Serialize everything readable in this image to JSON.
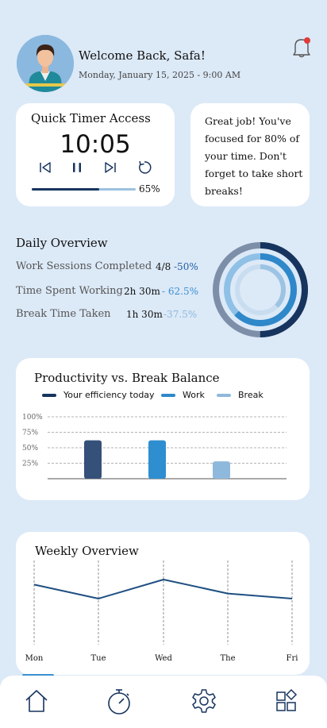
{
  "header": {
    "welcome": "Welcome Back, Safa!",
    "date": "Monday, January 15, 2025 - 9:00 AM",
    "notification_icon": "bell-icon",
    "has_notification": true
  },
  "timer": {
    "title": "Quick Timer Access",
    "time": "10:05",
    "progress": 0.65,
    "progress_label": "65%",
    "controls": [
      "skip-back-icon",
      "pause-icon",
      "skip-forward-icon",
      "restart-icon"
    ]
  },
  "tip": {
    "text": "Great job! You've focused for 80% of your time. Don't forget to take short breaks!"
  },
  "daily": {
    "title": "Daily Overview",
    "stats": [
      {
        "label": "Work Sessions Completed",
        "value": "4/8",
        "delta": "-50%",
        "delta_color": "#1f5fa8"
      },
      {
        "label": "Time Spent Working",
        "value": "2h 30m",
        "delta": "- 62.5%",
        "delta_color": "#3b8fd0"
      },
      {
        "label": "Break Time Taken",
        "value": "1h 30m",
        "delta": "-37.5%",
        "delta_color": "#8fb9dc"
      }
    ],
    "rings": [
      {
        "fraction": 0.5,
        "color": "#17345e",
        "track": "#7d8fa8"
      },
      {
        "fraction": 0.625,
        "color": "#2f88c9",
        "track": "#8fc0e6"
      },
      {
        "fraction": 0.375,
        "color": "#9cc3e3",
        "track": "#c9ddf0"
      }
    ]
  },
  "productivity": {
    "title": "Productivity vs. Break Balance",
    "legend": [
      {
        "label": "Your efficiency today",
        "color": "#17345e"
      },
      {
        "label": "Work",
        "color": "#2f88c9"
      },
      {
        "label": "Break",
        "color": "#8fb9dc"
      }
    ],
    "chart_data": {
      "type": "bar",
      "categories": [
        "Your efficiency today",
        "Work",
        "Break"
      ],
      "values": [
        62,
        62,
        28
      ],
      "colors": [
        "#35517a",
        "#2f8ed0",
        "#8fb9dc"
      ],
      "y_ticks": [
        "100%",
        "75%",
        "50%",
        "25%"
      ],
      "ylim": [
        0,
        100
      ]
    }
  },
  "weekly": {
    "title": "Weekly Overview",
    "chart_data": {
      "type": "line",
      "categories": [
        "Mon",
        "Tue",
        "Wed",
        "The",
        "Fri"
      ],
      "values": [
        72,
        50,
        80,
        58,
        50
      ],
      "ylim": [
        0,
        100
      ],
      "color": "#1f4f82"
    }
  },
  "nav": {
    "items": [
      "home-icon",
      "timer-icon",
      "settings-icon",
      "apps-icon"
    ],
    "active": 0
  }
}
